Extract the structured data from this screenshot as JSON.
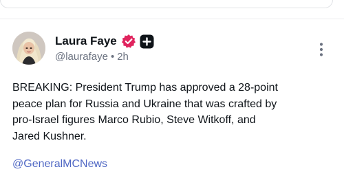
{
  "author": {
    "name": "Laura Faye",
    "handle": "@laurafaye",
    "separator": "•",
    "time": "2h"
  },
  "icons": {
    "verified": "verified-badge-icon",
    "plus": "plus-badge-icon",
    "more": "more-vertical-icon",
    "verified_color": "#e0245e",
    "plus_color": "#0f1419"
  },
  "post": {
    "text": "BREAKING: President Trump has approved a 28-point\npeace plan for Russia and Ukraine that was crafted by\npro-Israel figures Marco Rubio, Steve Witkoff, and\nJared Kushner.",
    "mention": "@GeneralMCNews"
  },
  "colors": {
    "link": "#4f67c4",
    "secondary_text": "#6b7280"
  }
}
